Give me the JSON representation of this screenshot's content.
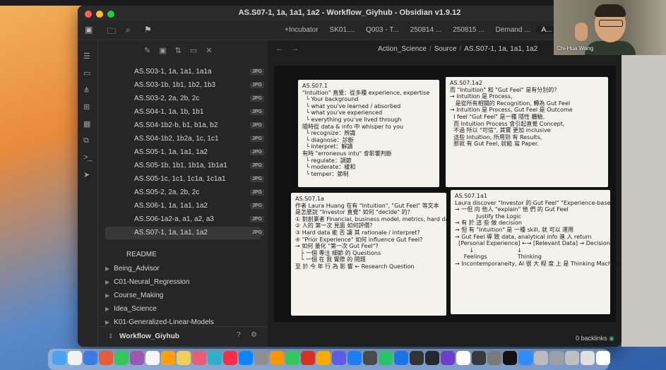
{
  "window": {
    "title": "AS.S07-1, 1a, 1a1, 1a2 - Workflow_Giyhub - Obsidian v1.9.12"
  },
  "tabs": [
    "+Incubator",
    "SK01....",
    "Q003 - T...",
    "250814 ...",
    "250815 ...",
    "Demand ...",
    "A..."
  ],
  "sidebar": {
    "files": [
      {
        "name": "AS.S03-1, 1a, 1a1, 1a1a",
        "badge": "JPG"
      },
      {
        "name": "AS.S03-1b, 1b1, 1b2, 1b3",
        "badge": "JPG"
      },
      {
        "name": "AS.S03-2, 2a, 2b, 2c",
        "badge": "JPG"
      },
      {
        "name": "AS.S04-1, 1a, 1b, 1b1",
        "badge": "JPG"
      },
      {
        "name": "AS.S04-1b2-b, b1, b1a, b2",
        "badge": "JPG"
      },
      {
        "name": "AS.S04-1b2, 1b2a, 1c, 1c1",
        "badge": "JPG"
      },
      {
        "name": "AS.S05-1, 1a, 1a1, 1a2",
        "badge": "JPG"
      },
      {
        "name": "AS.S05-1b, 1b1, 1b1a, 1b1a1",
        "badge": "JPG"
      },
      {
        "name": "AS.S05-1c, 1c1, 1c1a, 1c1a1",
        "badge": "JPG"
      },
      {
        "name": "AS.S05-2, 2a, 2b, 2c",
        "badge": "JPG"
      },
      {
        "name": "AS.S06-1, 1a, 1a1, 1a2",
        "badge": "JPG"
      },
      {
        "name": "AS.S06-1a2-a, a1, a2, a3",
        "badge": "JPG"
      },
      {
        "name": "AS.S07-1, 1a, 1a1, 1a2",
        "badge": "JPG"
      }
    ],
    "readme": "README",
    "folders": [
      "Being_Advisor",
      "C01-Neural_Regression",
      "Course_Making",
      "Idea_Science",
      "K01-Generalized-Linear-Models"
    ],
    "vault_name": "Workflow_Giyhub"
  },
  "breadcrumb": [
    "Action_Science",
    "Source",
    "AS.S07-1, 1a, 1a1, 1a2"
  ],
  "cards": [
    {
      "label": "AS.S07.1",
      "text": "AS.S07.1\n\"Intuition\" 直覺：從多種 experience, expertise\n  └ Your background\n  └ what you've learned / absorbed\n  └ what you've experienced\n  └ everything you've lived through\n隨時從 data & info 中 whisper to you\n  └ recognize：辨識\n  └ diagnose：診斷\n  └ interpret：解讀\n有時 \"erroneous intu\" 會影響判斷\n  └ regulate：調節\n  └ moderate：緩和\n  └ temper：節制"
    },
    {
      "label": "AS.S07.1a2",
      "text": "AS.S07.1a2\n而 \"Intuition\" 和 \"Gut Feel\" 是有分別的？\n→ Intuition 是 Process,\n   是從所有相關的 Recognition, 轉為 Gut Feel\n→ Intuition 是 Process, Gut Feel 是 Outcome\n  I feel \"Gut Feel\" 是一種 隱性 體驗,\n  而 Intuition Process 會引起直覺 Concept,\n  不過 所以 \"可信\", 其實 更加 inclusive\n  這些 Intuition, 所用到 有 Results,\n  那就 有 Gut Feel, 就能 寫 Paper."
    },
    {
      "label": "AS.S07.1a",
      "text": "AS.S07.1a\n作者 Laura Huang 在有 \"Intuition\", \"Gut Feel\" 等文本\n是怎麼說 \"Investor 直覺\" 如何 \"decide\" 的？\n① 對創業者 Financial, business model, metrics, hard data?\n② 人的 第一次 見面 如何評價？\n③ Hard data 能 否 讓 其 rationale / interpret?\n④ \"Prior Experience\" 如何 influence Gut Feel?\n→ 如何 量化 \"第一次 Gut Feel\"?\n   ├ 一個 專注 細節 的 Questions\n   └ 一個 在 我 實際 的 問題\n至 於 今 年 行 為 影 響 ← Research Question"
    },
    {
      "label": "AS.S07.1a1",
      "text": "AS.S07.1a1\nLaura discover \"Investor 的 Gut Feel\" \"Experience-based\"\n→ 一但 向 他人 \"explain\" 他 們 的 Gut Feel\n            Justify the Logic\n→ 有 於 這 些 做 decision\n→ 但 有 \"Intuition\" 是 一種 skill, 就 可以 運用\n→ Gut Feel 導 致 data, analytical info 進 入 return\n  [Personal Experience] ←→ [Relevant Data] → Decision\n        ↓                        ↓\n     Feelings                 Thinking\n→ Incontemporaneity, AI 很 大 程 度 上 是 Thinking Machine"
    }
  ],
  "backlinks": "0 backlinks",
  "webcam": {
    "label": "Chi-Hua Wang"
  },
  "dock": {
    "colors": [
      "#4aa3f0",
      "#f2f2f2",
      "#3c7ce0",
      "#e55b3c",
      "#34c759",
      "#9b59b6",
      "#f5f5f5",
      "#ff9f0a",
      "#f0d05a",
      "#e85d75",
      "#30b0c7",
      "#fa2d48",
      "#0a84ff",
      "#8e8e93",
      "#ff9500",
      "#34c759",
      "#d93025",
      "#f9ab00",
      "#5e5ce6",
      "#1c7ef5",
      "#4a4a4a",
      "#29c46a",
      "#1a73e8",
      "#333333",
      "#24292f",
      "#6e40c9",
      "#ffffff",
      "#3a3a3a",
      "#7a7a7a",
      "#111111",
      "#2d8cff",
      "#bbbbbb",
      "#9aa0a6",
      "#c0c0c0",
      "#e0e0e0",
      "#ffffff"
    ]
  }
}
